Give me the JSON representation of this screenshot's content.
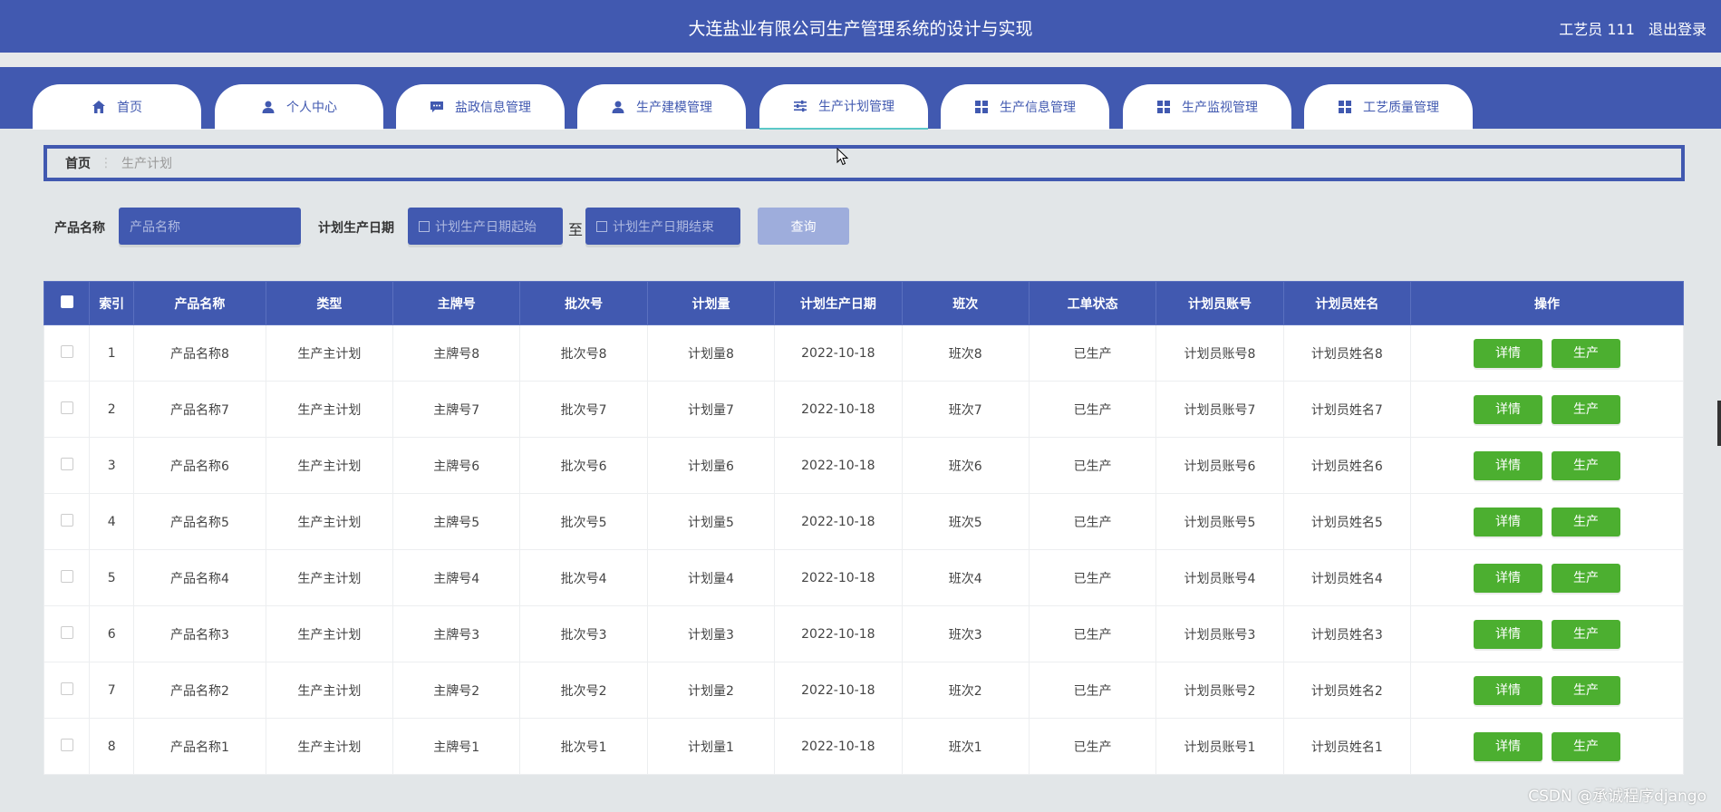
{
  "header": {
    "title": "大连盐业有限公司生产管理系统的设计与实现",
    "user": "工艺员 111",
    "logout": "退出登录"
  },
  "nav": {
    "tabs": [
      {
        "label": "首页",
        "icon": "home-icon"
      },
      {
        "label": "个人中心",
        "icon": "user-icon"
      },
      {
        "label": "盐政信息管理",
        "icon": "chat-icon"
      },
      {
        "label": "生产建模管理",
        "icon": "user-icon"
      },
      {
        "label": "生产计划管理",
        "icon": "sliders-icon"
      },
      {
        "label": "生产信息管理",
        "icon": "grid-icon"
      },
      {
        "label": "生产监视管理",
        "icon": "grid-icon"
      },
      {
        "label": "工艺质量管理",
        "icon": "grid-icon"
      }
    ]
  },
  "breadcrumb": {
    "home": "首页",
    "current": "生产计划"
  },
  "search": {
    "name_label": "产品名称",
    "name_placeholder": "产品名称",
    "date_label": "计划生产日期",
    "date_start_placeholder": "计划生产日期起始",
    "to": "至",
    "date_end_placeholder": "计划生产日期结束",
    "query": "查询"
  },
  "table": {
    "headers": [
      "索引",
      "产品名称",
      "类型",
      "主牌号",
      "批次号",
      "计划量",
      "计划生产日期",
      "班次",
      "工单状态",
      "计划员账号",
      "计划员姓名",
      "操作"
    ],
    "detail_label": "详情",
    "produce_label": "生产",
    "rows": [
      [
        "1",
        "产品名称8",
        "生产主计划",
        "主牌号8",
        "批次号8",
        "计划量8",
        "2022-10-18",
        "班次8",
        "已生产",
        "计划员账号8",
        "计划员姓名8"
      ],
      [
        "2",
        "产品名称7",
        "生产主计划",
        "主牌号7",
        "批次号7",
        "计划量7",
        "2022-10-18",
        "班次7",
        "已生产",
        "计划员账号7",
        "计划员姓名7"
      ],
      [
        "3",
        "产品名称6",
        "生产主计划",
        "主牌号6",
        "批次号6",
        "计划量6",
        "2022-10-18",
        "班次6",
        "已生产",
        "计划员账号6",
        "计划员姓名6"
      ],
      [
        "4",
        "产品名称5",
        "生产主计划",
        "主牌号5",
        "批次号5",
        "计划量5",
        "2022-10-18",
        "班次5",
        "已生产",
        "计划员账号5",
        "计划员姓名5"
      ],
      [
        "5",
        "产品名称4",
        "生产主计划",
        "主牌号4",
        "批次号4",
        "计划量4",
        "2022-10-18",
        "班次4",
        "已生产",
        "计划员账号4",
        "计划员姓名4"
      ],
      [
        "6",
        "产品名称3",
        "生产主计划",
        "主牌号3",
        "批次号3",
        "计划量3",
        "2022-10-18",
        "班次3",
        "已生产",
        "计划员账号3",
        "计划员姓名3"
      ],
      [
        "7",
        "产品名称2",
        "生产主计划",
        "主牌号2",
        "批次号2",
        "计划量2",
        "2022-10-18",
        "班次2",
        "已生产",
        "计划员账号2",
        "计划员姓名2"
      ],
      [
        "8",
        "产品名称1",
        "生产主计划",
        "主牌号1",
        "批次号1",
        "计划量1",
        "2022-10-18",
        "班次1",
        "已生产",
        "计划员账号1",
        "计划员姓名1"
      ]
    ]
  },
  "watermark": "CSDN @承诚程序django",
  "colors": {
    "primary": "#4159b0",
    "button_green": "#4caf30",
    "query_disabled": "#9eaddc",
    "background": "#e2e6e8"
  }
}
